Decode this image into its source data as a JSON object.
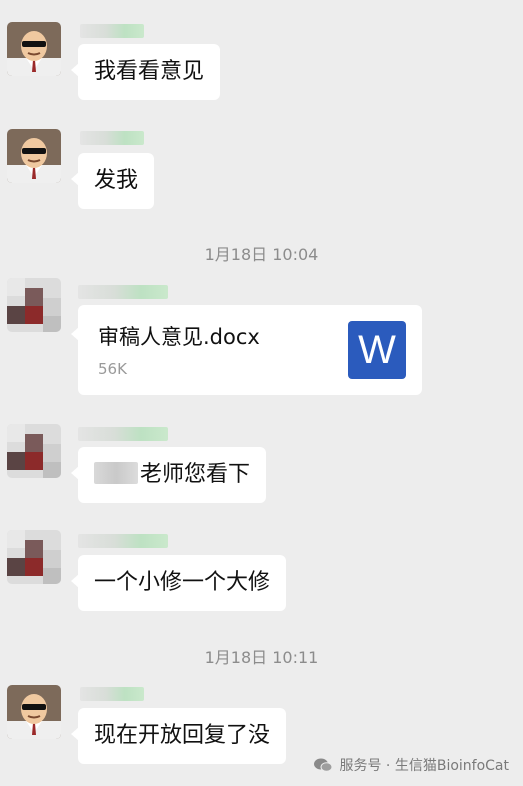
{
  "messages": [
    {
      "text": "我看看意见"
    },
    {
      "text": "发我"
    },
    {
      "text": "老师您看下"
    },
    {
      "text": "一个小修一个大修"
    },
    {
      "text": "现在开放回复了没"
    }
  ],
  "timestamps": [
    "1月18日 10:04",
    "1月18日 10:11"
  ],
  "file": {
    "name": "审稿人意见.docx",
    "size": "56K",
    "icon_letter": "W",
    "icon_color": "#2b5bbd"
  },
  "watermark": {
    "label": "服务号 · 生信猫BioinfoCat"
  },
  "colors": {
    "background": "#ededed",
    "bubble": "#ffffff",
    "timestamp": "#8c8c8c"
  }
}
